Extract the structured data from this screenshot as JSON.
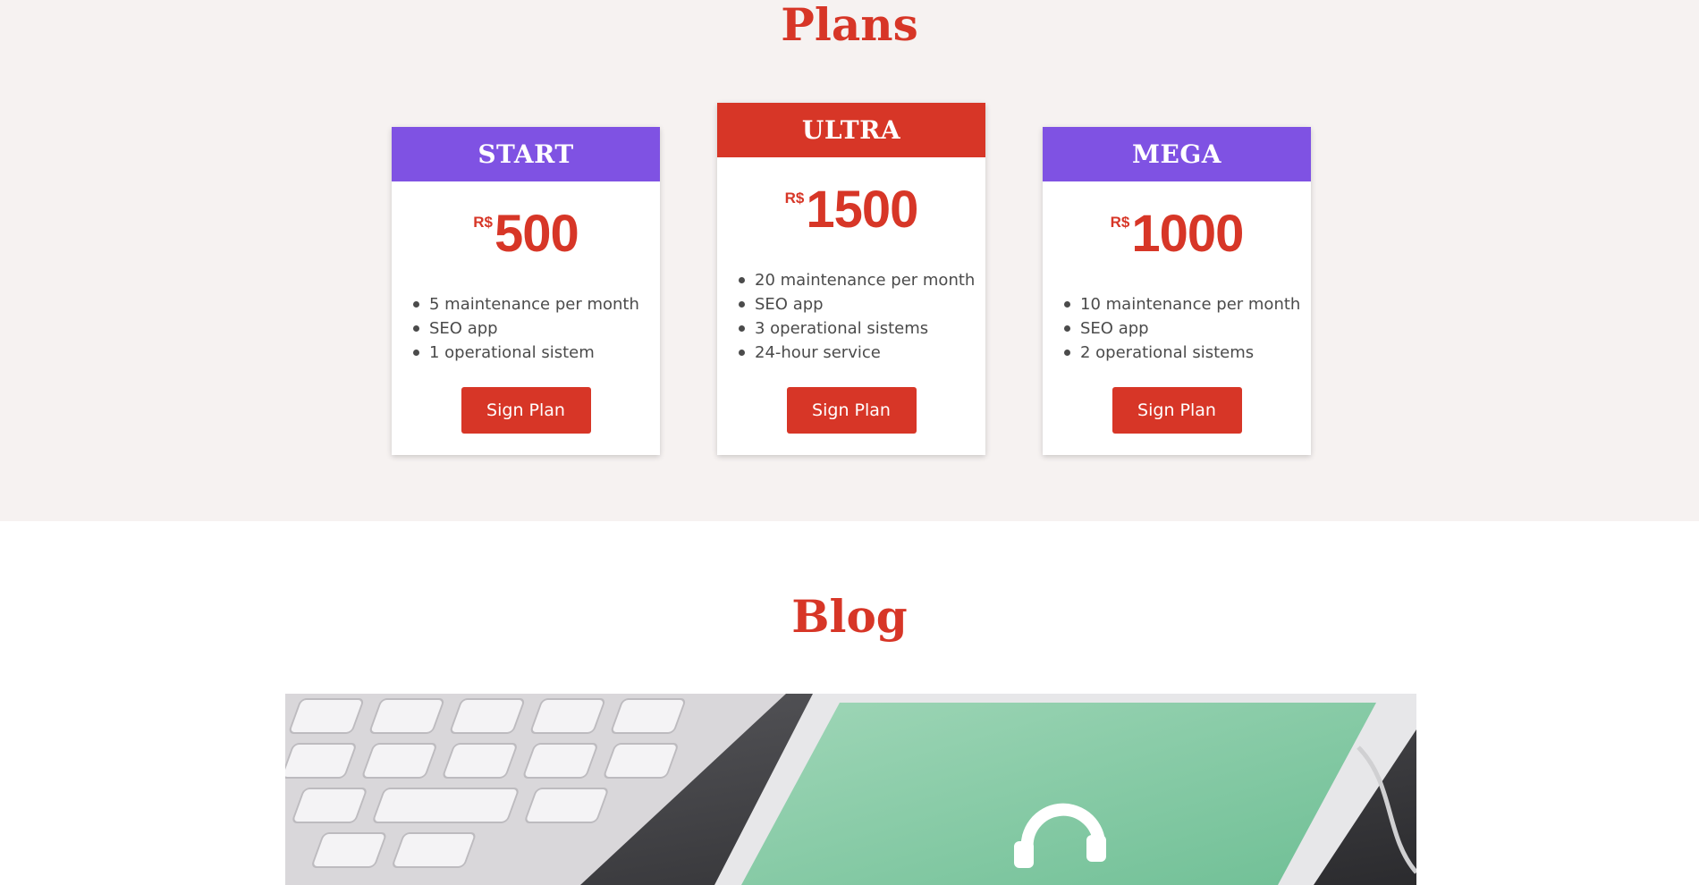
{
  "plans": {
    "title": "Plans",
    "cards": [
      {
        "name": "START",
        "currency": "R$",
        "amount": "500",
        "features": [
          "5 maintenance per month",
          "SEO app",
          "1 operational sistem"
        ],
        "button_label": "Sign Plan",
        "header_color": "#7f52e3"
      },
      {
        "name": "ULTRA",
        "currency": "R$",
        "amount": "1500",
        "features": [
          "20 maintenance per month",
          "SEO app",
          "3 operational sistems",
          "24-hour service"
        ],
        "button_label": "Sign Plan",
        "header_color": "#d73627"
      },
      {
        "name": "MEGA",
        "currency": "R$",
        "amount": "1000",
        "features": [
          "10 maintenance per month",
          "SEO app",
          "2 operational sistems"
        ],
        "button_label": "Sign Plan",
        "header_color": "#7f52e3"
      }
    ]
  },
  "blog": {
    "title": "Blog",
    "image_icon": "headphones-icon"
  },
  "colors": {
    "accent": "#d73627",
    "purple": "#7f52e3",
    "plans_background": "#f6f2f1"
  }
}
